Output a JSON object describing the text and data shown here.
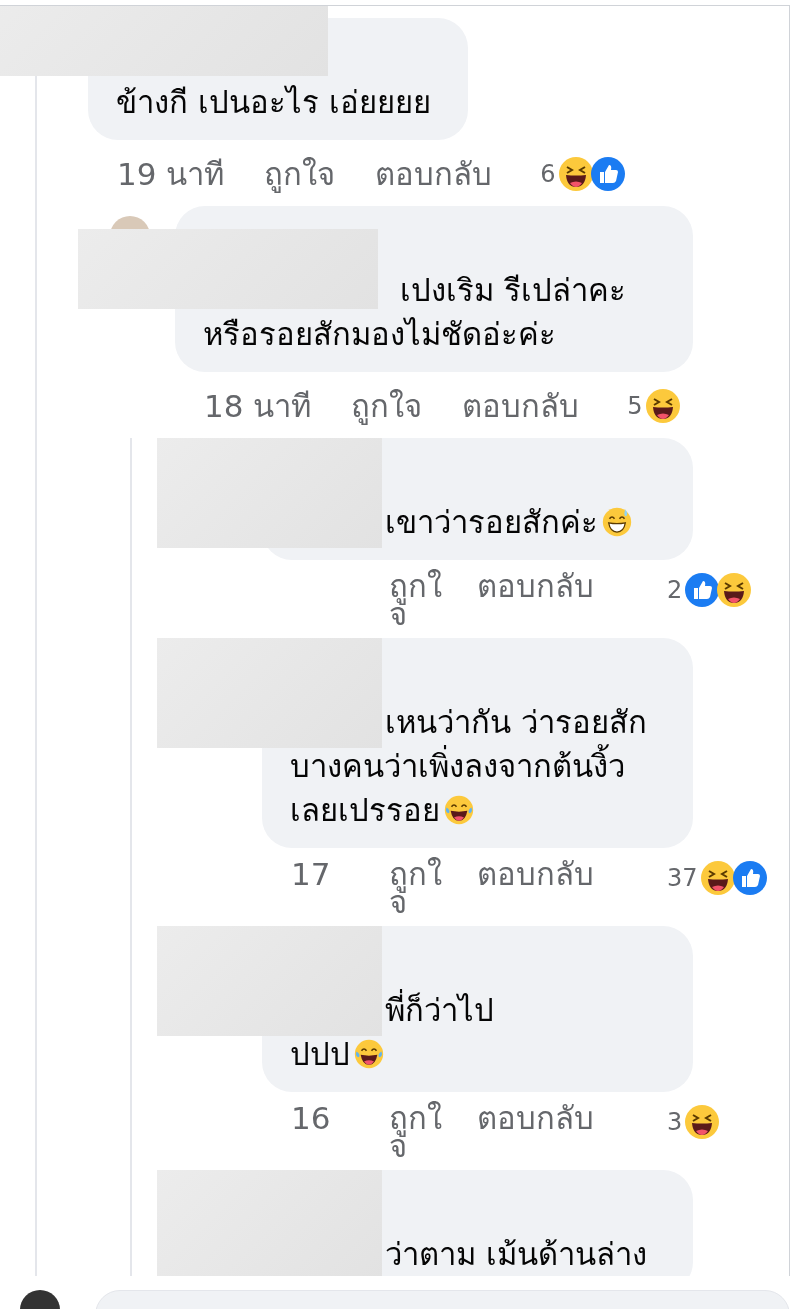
{
  "thread": [
    {
      "author_hidden": true,
      "lines": [
        {
          "parts": [
            {
              "kind": "text",
              "text": "ข้างกี เปนอะไร เอ่ยยยย"
            }
          ]
        }
      ],
      "time": "19 นาที",
      "like": "ถูกใจ",
      "reply": "ตอบกลับ",
      "reaction_count": "6",
      "reactions": [
        {
          "kind": "haha"
        },
        {
          "kind": "like"
        }
      ],
      "children": [
        {
          "author_hidden": true,
          "lines": [
            {
              "obscured_start": true,
              "parts": [
                {
                  "kind": "text",
                  "text": "เปงเริม รีเปล่าคะ"
                }
              ]
            },
            {
              "parts": [
                {
                  "kind": "text",
                  "text": "หรือรอยสักมองไม่ชัดอ่ะค่ะ"
                }
              ]
            }
          ],
          "time": "18 นาที",
          "like": "ถูกใจ",
          "reply": "ตอบกลับ",
          "reaction_count": "5",
          "reactions": [
            {
              "kind": "haha"
            }
          ],
          "children": [
            {
              "author_hidden": true,
              "lines": [
                {
                  "obscured_start": true,
                  "parts": [
                    {
                      "kind": "text",
                      "text": "เขาว่ารอยสักค่ะ"
                    },
                    {
                      "kind": "sweat"
                    }
                  ]
                }
              ],
              "like": "ถูกใจ",
              "reply": "ตอบกลับ",
              "reaction_count": "2",
              "reactions": [
                {
                  "kind": "like"
                },
                {
                  "kind": "haha"
                }
              ]
            },
            {
              "author_hidden": true,
              "lines": [
                {
                  "obscured_start": true,
                  "parts": [
                    {
                      "kind": "text",
                      "text": "เหนว่ากัน ว่ารอยสัก"
                    }
                  ]
                },
                {
                  "parts": [
                    {
                      "kind": "text",
                      "text": "บางคนว่าเพิ่งลงจากต้นงิ้ว"
                    }
                  ]
                },
                {
                  "parts": [
                    {
                      "kind": "text",
                      "text": "เลยเปรรอย"
                    },
                    {
                      "kind": "joy"
                    }
                  ]
                }
              ],
              "time": "17",
              "like": "ถูกใจ",
              "reply": "ตอบกลับ",
              "reaction_count": "37",
              "reactions": [
                {
                  "kind": "haha"
                },
                {
                  "kind": "like"
                }
              ]
            },
            {
              "author_hidden": true,
              "lines": [
                {
                  "obscured_start": true,
                  "parts": [
                    {
                      "kind": "text",
                      "text": "พี่ก็ว่าไป"
                    }
                  ]
                },
                {
                  "parts": [
                    {
                      "kind": "text",
                      "text": "ปปป"
                    },
                    {
                      "kind": "joy"
                    }
                  ]
                }
              ],
              "time": "16",
              "like": "ถูกใจ",
              "reply": "ตอบกลับ",
              "reaction_count": "3",
              "reactions": [
                {
                  "kind": "haha"
                }
              ]
            },
            {
              "author_hidden": true,
              "lines": [
                {
                  "obscured_start": true,
                  "parts": [
                    {
                      "kind": "text",
                      "text": "ว่าตาม เม้นด้านล่าง"
                    }
                  ]
                }
              ]
            }
          ]
        }
      ]
    }
  ]
}
